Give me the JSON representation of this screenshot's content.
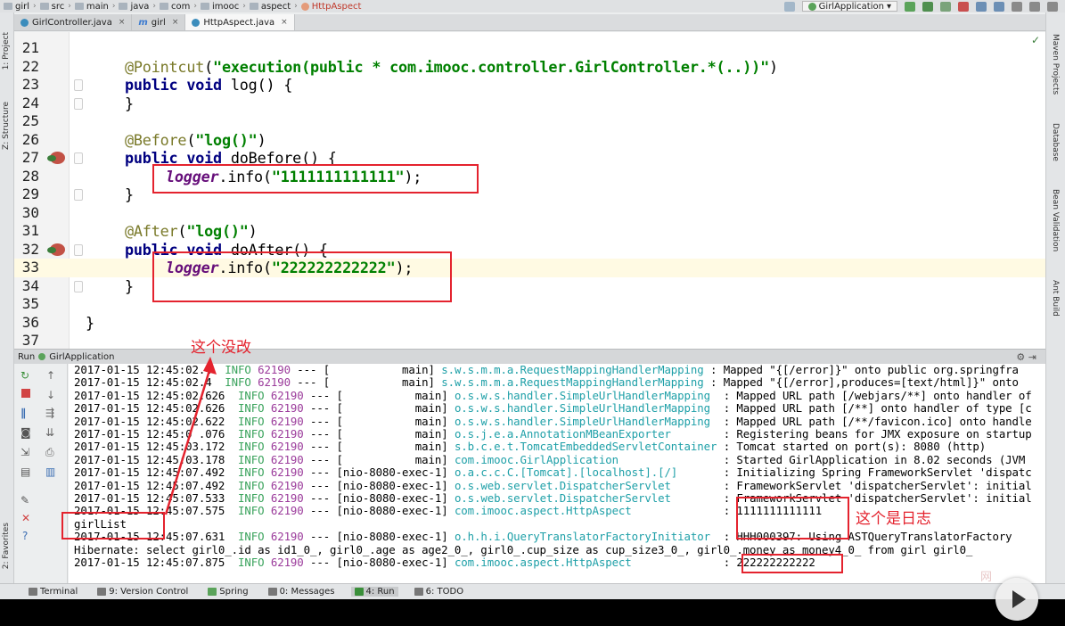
{
  "breadcrumbs": [
    "girl",
    "src",
    "main",
    "java",
    "com",
    "imooc",
    "aspect",
    "HttpAspect"
  ],
  "run_config": "GirlApplication",
  "tabs": [
    {
      "label": "GirlController.java",
      "active": false
    },
    {
      "label": "girl",
      "active": false
    },
    {
      "label": "HttpAspect.java",
      "active": true
    }
  ],
  "left_strip": {
    "project": "1: Project",
    "structure": "Z: Structure",
    "favorites": "2: Favorites"
  },
  "right_strip": {
    "maven": "Maven Projects",
    "database": "Database",
    "bean": "Bean Validation",
    "ant": "Ant Build"
  },
  "code_lines": [
    {
      "n": "21"
    },
    {
      "n": "22"
    },
    {
      "n": "23"
    },
    {
      "n": "24"
    },
    {
      "n": "25"
    },
    {
      "n": "26"
    },
    {
      "n": "27"
    },
    {
      "n": "28"
    },
    {
      "n": "29"
    },
    {
      "n": "30"
    },
    {
      "n": "31"
    },
    {
      "n": "32"
    },
    {
      "n": "33"
    },
    {
      "n": "34"
    },
    {
      "n": "35"
    },
    {
      "n": "36"
    },
    {
      "n": "37"
    }
  ],
  "code": {
    "l22_ann": "@Pointcut",
    "l22_p1": "(",
    "l22_str1": "\"",
    "l22_k1": "execution",
    "l22_p2": "(",
    "l22_k2": "public",
    "l22_rest": " * com.imooc.controller.GirlController.*(..))\"",
    "l22_end": ")",
    "l23_k1": "public",
    "l23_k2": "void",
    "l23_rest": " log() {",
    "l24": "}",
    "l26_ann": "@Before",
    "l26_p1": "(",
    "l26_str": "\"log()\"",
    "l26_p2": ")",
    "l27_k1": "public",
    "l27_k2": "void",
    "l27_rest": " doBefore() {",
    "l28_fld": "logger",
    "l28_m": ".info(",
    "l28_str": "\"1111111111111\"",
    "l28_end": ");",
    "l29": "}",
    "l31_ann": "@After",
    "l31_p1": "(",
    "l31_str": "\"log()\"",
    "l31_p2": ")",
    "l32_k1": "public",
    "l32_k2": "void",
    "l32_rest": " doAfter() {",
    "l33_fld": "logger",
    "l33_m": ".info(",
    "l33_str": "\"222222222222\"",
    "l33_end": ");",
    "l34": "}",
    "l36": "}"
  },
  "run_panel": {
    "label": "Run",
    "config": "GirlApplication"
  },
  "log": [
    {
      "ts": "2017-01-15 12:45:02.4",
      "lvl": "INFO",
      "pid": "62190",
      "mid": " --- [           main] ",
      "logger": "s.w.s.m.m.a.RequestMappingHandlerMapping",
      "msg": " : Mapped \"{[/error]}\" onto public org.springfra"
    },
    {
      "ts": "2017-01-15 12:45:02.4",
      "lvl": "INFO",
      "pid": "62190",
      "mid": " --- [           main] ",
      "logger": "s.w.s.m.m.a.RequestMappingHandlerMapping",
      "msg": " : Mapped \"{[/error],produces=[text/html]}\" onto"
    },
    {
      "ts": "2017-01-15 12:45:02.626",
      "lvl": "INFO",
      "pid": "62190",
      "mid": " --- [           main] ",
      "logger": "o.s.w.s.handler.SimpleUrlHandlerMapping ",
      "msg": " : Mapped URL path [/webjars/**] onto handler of"
    },
    {
      "ts": "2017-01-15 12:45:02.626",
      "lvl": "INFO",
      "pid": "62190",
      "mid": " --- [           main] ",
      "logger": "o.s.w.s.handler.SimpleUrlHandlerMapping ",
      "msg": " : Mapped URL path [/**] onto handler of type [c"
    },
    {
      "ts": "2017-01-15 12:45:02.622",
      "lvl": "INFO",
      "pid": "62190",
      "mid": " --- [           main] ",
      "logger": "o.s.w.s.handler.SimpleUrlHandlerMapping ",
      "msg": " : Mapped URL path [/**/favicon.ico] onto handle"
    },
    {
      "ts": "2017-01-15 12:45:0 .076",
      "lvl": "INFO",
      "pid": "62190",
      "mid": " --- [           main] ",
      "logger": "o.s.j.e.a.AnnotationMBeanExporter       ",
      "msg": " : Registering beans for JMX exposure on startup"
    },
    {
      "ts": "2017-01-15 12:45:03.172",
      "lvl": "INFO",
      "pid": "62190",
      "mid": " --- [           main] ",
      "logger": "s.b.c.e.t.TomcatEmbeddedServletContainer",
      "msg": " : Tomcat started on port(s): 8080 (http)"
    },
    {
      "ts": "2017-01-15 12:45:03.178",
      "lvl": "INFO",
      "pid": "62190",
      "mid": " --- [           main] ",
      "logger": "com.imooc.GirlApplication               ",
      "msg": " : Started GirlApplication in 8.02 seconds (JVM"
    },
    {
      "ts": "2017-01-15 12:45:07.492",
      "lvl": "INFO",
      "pid": "62190",
      "mid": " --- [nio-8080-exec-1] ",
      "logger": "o.a.c.c.C.[Tomcat].[localhost].[/]      ",
      "msg": " : Initializing Spring FrameworkServlet 'dispatc"
    },
    {
      "ts": "2017-01-15 12:45:07.492",
      "lvl": "INFO",
      "pid": "62190",
      "mid": " --- [nio-8080-exec-1] ",
      "logger": "o.s.web.servlet.DispatcherServlet       ",
      "msg": " : FrameworkServlet 'dispatcherServlet': initial"
    },
    {
      "ts": "2017-01-15 12:45:07.533",
      "lvl": "INFO",
      "pid": "62190",
      "mid": " --- [nio-8080-exec-1] ",
      "logger": "o.s.web.servlet.DispatcherServlet       ",
      "msg": " : FrameworkServlet 'dispatcherServlet': initial"
    },
    {
      "ts": "2017-01-15 12:45:07.575",
      "lvl": "INFO",
      "pid": "62190",
      "mid": " --- [nio-8080-exec-1] ",
      "logger": "com.imooc.aspect.HttpAspect             ",
      "msg": " : 1111111111111"
    },
    {
      "plain": "girlList"
    },
    {
      "ts": "2017-01-15 12:45:07.631",
      "lvl": "INFO",
      "pid": "62190",
      "mid": " --- [nio-8080-exec-1] ",
      "logger": "o.h.h.i.QueryTranslatorFactoryInitiator ",
      "msg": " : HHH000397: Using ASTQueryTranslatorFactory"
    },
    {
      "plain": "Hibernate: select girl0_.id as id1_0_, girl0_.age as age2_0_, girl0_.cup_size as cup_size3_0_, girl0_.money as money4_0_ from girl girl0_"
    },
    {
      "ts": "2017-01-15 12:45:07.875",
      "lvl": "INFO",
      "pid": "62190",
      "mid": " --- [nio-8080-exec-1] ",
      "logger": "com.imooc.aspect.HttpAspect             ",
      "msg": " : 222222222222"
    }
  ],
  "bottom_tabs": [
    {
      "label": "Terminal",
      "active": false
    },
    {
      "label": "9: Version Control",
      "active": false
    },
    {
      "label": "Spring",
      "active": false
    },
    {
      "label": "0: Messages",
      "active": false
    },
    {
      "label": "4: Run",
      "active": true
    },
    {
      "label": "6: TODO",
      "active": false
    }
  ],
  "callouts": {
    "unchanged": "这个没改",
    "is_log": "这个是日志"
  },
  "watermark": "网",
  "colors": {
    "annotation": "#7a7a2a",
    "keyword": "#000080",
    "string": "#008000",
    "field": "#660e7a",
    "log_info": "#3aa35c",
    "log_logger": "#1fa0a8",
    "highlight_box": "#e4232e"
  }
}
